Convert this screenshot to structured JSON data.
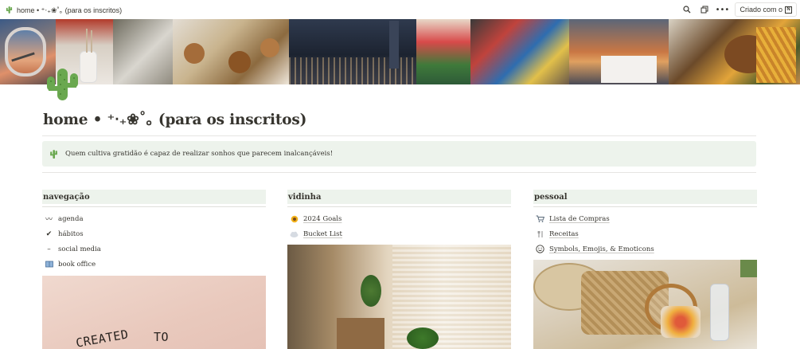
{
  "topbar": {
    "breadcrumb_title": "home • ⁺‧₊❀˚｡ (para os inscritos)",
    "made_with_label": "Criado com o",
    "made_with_logo_letter": "N"
  },
  "page": {
    "title": "home • ⁺‧₊❀˚｡ (para os inscritos)"
  },
  "callout": {
    "text": "Quem cultiva gratidão é capaz de realizar sonhos que parecem inalcançáveis!"
  },
  "columns": [
    {
      "heading": "navegação",
      "items": [
        {
          "label": "agenda",
          "icon": "wave-icon",
          "glyph": "〰"
        },
        {
          "label": "hábitos",
          "icon": "checkmark-icon",
          "glyph": "✔"
        },
        {
          "label": "social media",
          "icon": "dash-icon",
          "glyph": "–"
        },
        {
          "label": "book office",
          "icon": "book-icon",
          "glyph": "📖"
        }
      ],
      "image_text_1": "CREATED",
      "image_text_2": "TO"
    },
    {
      "heading": "vidinha",
      "items": [
        {
          "label": "2024 Goals",
          "icon": "sunflower-icon",
          "glyph": "🌻",
          "underlined": true
        },
        {
          "label": "Bucket List",
          "icon": "cloud-icon",
          "glyph": "☁",
          "underlined": true
        }
      ]
    },
    {
      "heading": "pessoal",
      "items": [
        {
          "label": "Lista de Compras",
          "icon": "cart-icon",
          "glyph": "🛒",
          "underlined": true
        },
        {
          "label": "Receitas",
          "icon": "recipe-icon",
          "glyph": "🍴",
          "underlined": true
        },
        {
          "label": "Symbols, Emojis, & Emoticons",
          "icon": "smiley-icon",
          "glyph": "☺",
          "underlined": true
        }
      ]
    }
  ],
  "colors": {
    "text": "#37352f",
    "heading_bg": "#edf3ec",
    "callout_bg": "#edf3ec",
    "cactus": "#6aa84f",
    "divider": "#e6e5e2"
  }
}
